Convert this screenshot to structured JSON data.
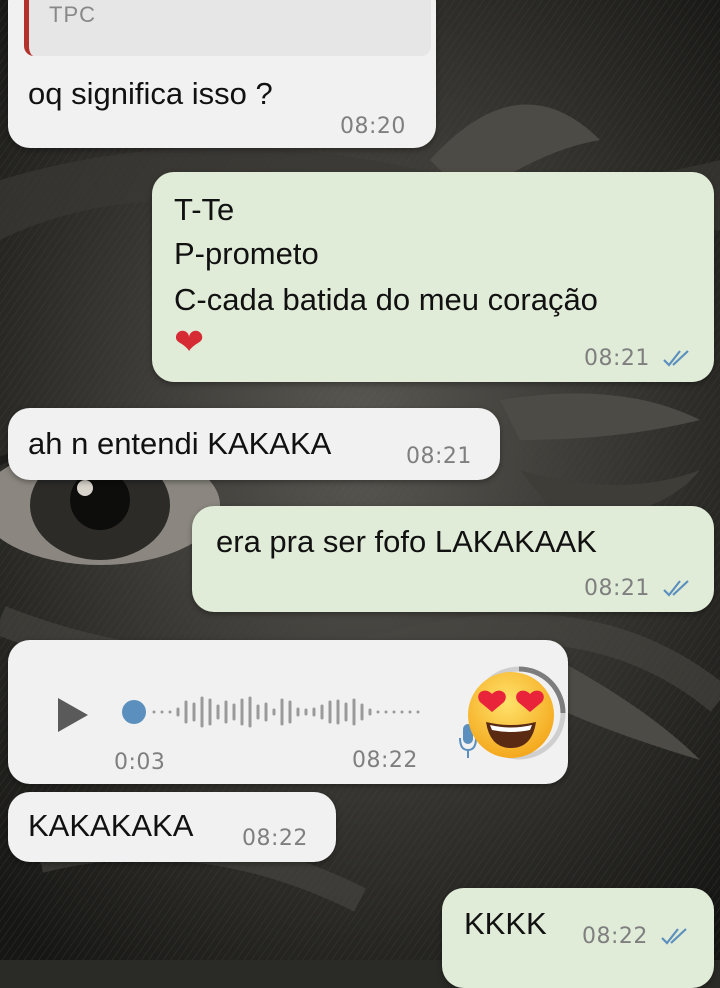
{
  "messages": [
    {
      "id": "m1",
      "side": "in",
      "quote": {
        "label": "TPC"
      },
      "lines": [
        "oq significa isso ?"
      ],
      "time": "08:20"
    },
    {
      "id": "m2",
      "side": "out",
      "lines": [
        "T-Te",
        "P-prometo",
        "C-cada batida do meu coração"
      ],
      "heart": "❤️",
      "time": "08:21",
      "ticks": "double-check-icon"
    },
    {
      "id": "m3",
      "side": "in",
      "lines": [
        "ah n entendi KAKAKA"
      ],
      "time": "08:21"
    },
    {
      "id": "m4",
      "side": "out",
      "lines": [
        "era pra ser fofo LAKAKAAK"
      ],
      "time": "08:21",
      "ticks": "double-check-icon"
    },
    {
      "id": "m5",
      "side": "in",
      "type": "voice",
      "duration": "0:03",
      "time": "08:22",
      "reaction": "heart-eyes-emoji"
    },
    {
      "id": "m6",
      "side": "in",
      "lines": [
        "KAKAKAKA"
      ],
      "time": "08:22"
    },
    {
      "id": "m7",
      "side": "out",
      "lines": [
        "KKKK"
      ],
      "time": "08:22",
      "ticks": "double-check-icon"
    }
  ],
  "colors": {
    "incoming": "#f1f1f1",
    "outgoing": "#e0ecd8",
    "ticks": "#5b8fbd",
    "voice_dot": "#5b8fbd"
  }
}
